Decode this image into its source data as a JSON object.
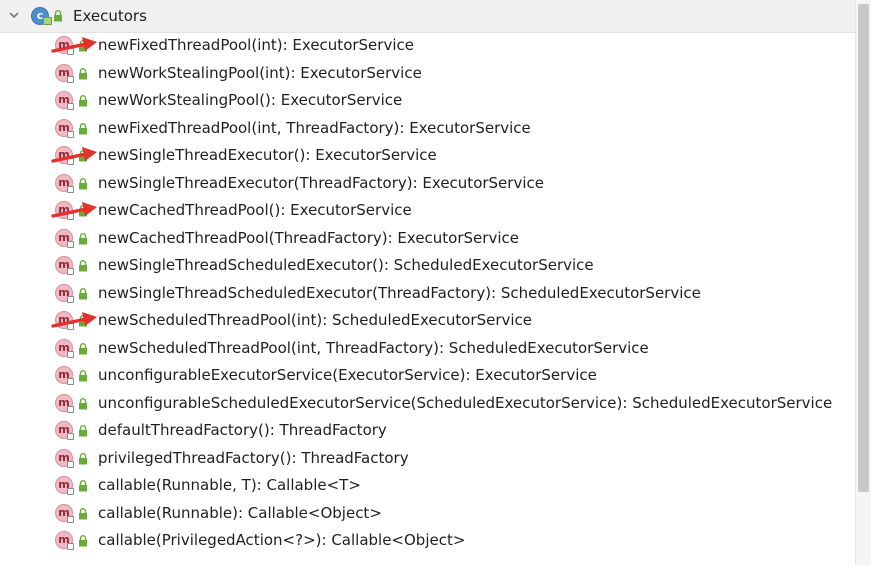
{
  "colors": {
    "method_icon_fill": "#f2b9c3",
    "class_icon_fill": "#4b8fc9",
    "lock_green": "#6aab3a",
    "annotation_arrow": "#e8302a",
    "text": "#1f1f1f"
  },
  "class_node": {
    "title": "Executors",
    "icon": "class-icon",
    "icon_letter": "c",
    "expanded": true
  },
  "method_icon_letter": "m",
  "methods": [
    {
      "signature": "newFixedThreadPool(int): ExecutorService",
      "highlighted": true
    },
    {
      "signature": "newWorkStealingPool(int): ExecutorService",
      "highlighted": false
    },
    {
      "signature": "newWorkStealingPool(): ExecutorService",
      "highlighted": false
    },
    {
      "signature": "newFixedThreadPool(int, ThreadFactory): ExecutorService",
      "highlighted": false
    },
    {
      "signature": "newSingleThreadExecutor(): ExecutorService",
      "highlighted": true
    },
    {
      "signature": "newSingleThreadExecutor(ThreadFactory): ExecutorService",
      "highlighted": false
    },
    {
      "signature": "newCachedThreadPool(): ExecutorService",
      "highlighted": true
    },
    {
      "signature": "newCachedThreadPool(ThreadFactory): ExecutorService",
      "highlighted": false
    },
    {
      "signature": "newSingleThreadScheduledExecutor(): ScheduledExecutorService",
      "highlighted": false
    },
    {
      "signature": "newSingleThreadScheduledExecutor(ThreadFactory): ScheduledExecutorService",
      "highlighted": false
    },
    {
      "signature": "newScheduledThreadPool(int): ScheduledExecutorService",
      "highlighted": true
    },
    {
      "signature": "newScheduledThreadPool(int, ThreadFactory): ScheduledExecutorService",
      "highlighted": false
    },
    {
      "signature": "unconfigurableExecutorService(ExecutorService): ExecutorService",
      "highlighted": false
    },
    {
      "signature": "unconfigurableScheduledExecutorService(ScheduledExecutorService): ScheduledExecutorService",
      "highlighted": false
    },
    {
      "signature": "defaultThreadFactory(): ThreadFactory",
      "highlighted": false
    },
    {
      "signature": "privilegedThreadFactory(): ThreadFactory",
      "highlighted": false
    },
    {
      "signature": "callable(Runnable, T): Callable<T>",
      "highlighted": false
    },
    {
      "signature": "callable(Runnable): Callable<Object>",
      "highlighted": false
    },
    {
      "signature": "callable(PrivilegedAction<?>): Callable<Object>",
      "highlighted": false
    }
  ]
}
